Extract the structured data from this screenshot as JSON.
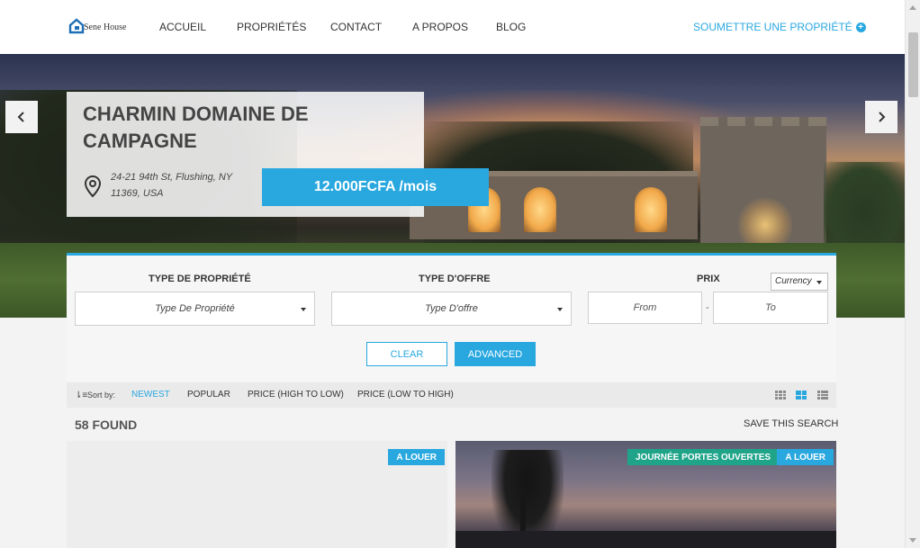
{
  "header": {
    "logo_text": "Sene House",
    "nav": [
      "ACCUEIL",
      "PROPRIÉTÉS",
      "CONTACT",
      "A PROPOS",
      "BLOG"
    ],
    "submit_label": "SOUMETTRE UNE PROPRIÉTÉ"
  },
  "hero": {
    "title": "CHARMIN DOMAINE DE CAMPAGNE",
    "address": "24-21 94th St, Flushing, NY 11369, USA",
    "price": "12.000FCFA /mois",
    "prev_icon": "chevron-left-icon",
    "next_icon": "chevron-right-icon"
  },
  "search": {
    "type_label": "TYPE DE PROPRIÉTÉ",
    "type_value": "Type De Propriété",
    "offer_label": "TYPE D'OFFRE",
    "offer_value": "Type D'offre",
    "price_label": "PRIX",
    "currency": "Currency",
    "from_placeholder": "From",
    "to_placeholder": "To",
    "clear_label": "CLEAR",
    "advanced_label": "ADVANCED",
    "accent_color": "#29a8e0"
  },
  "sort": {
    "label": "Sort by:",
    "options": [
      "NEWEST",
      "POPULAR",
      "PRICE (HIGH TO LOW)",
      "PRICE (LOW TO HIGH)"
    ],
    "active": "NEWEST"
  },
  "results": {
    "count_label": "58 FOUND",
    "save_label": "SAVE THIS SEARCH",
    "cards": [
      {
        "badges": [
          "A LOUER"
        ]
      },
      {
        "badges": [
          "JOURNÉE PORTES OUVERTES",
          "A LOUER"
        ]
      }
    ]
  }
}
